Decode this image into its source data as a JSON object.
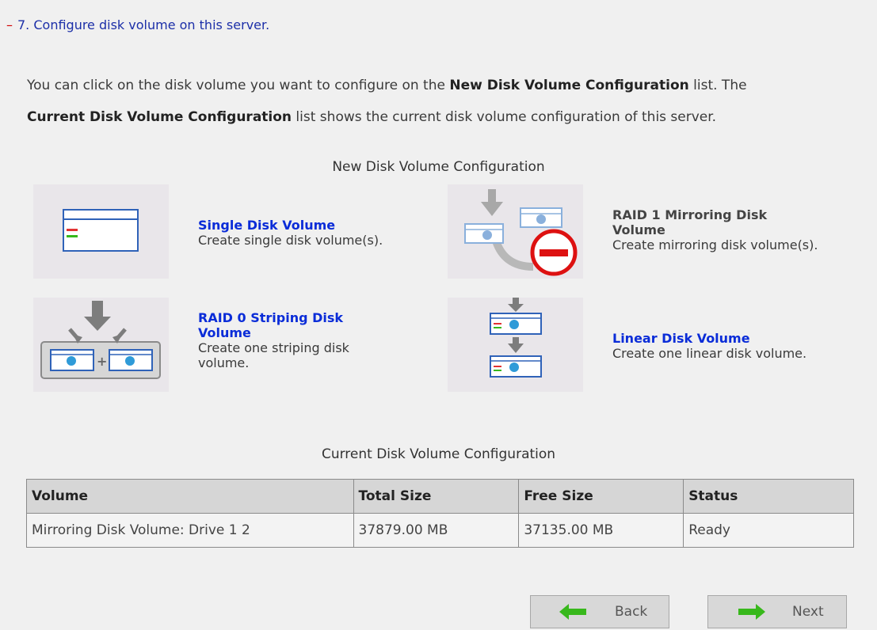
{
  "step": {
    "dash": "–",
    "text": "7. Configure disk volume on this server."
  },
  "intro": {
    "part1": "You can click on the disk volume you want to configure on the ",
    "bold1": "New Disk Volume Configuration",
    "part2": " list. The ",
    "bold2": "Current Disk Volume Configuration",
    "part3": " list shows the current disk volume configuration of this server."
  },
  "new_config": {
    "title": "New Disk Volume Configuration",
    "options": [
      {
        "title": "Single Disk Volume",
        "desc": "Create single disk volume(s).",
        "icon": "single-disk-icon"
      },
      {
        "title_line1": "RAID 1 Mirroring Disk",
        "title_line2": "Volume",
        "desc": "Create mirroring disk volume(s).",
        "icon": "raid1-mirroring-disabled-icon"
      },
      {
        "title_line1": "RAID 0 Striping Disk",
        "title_line2": "Volume",
        "desc_line1": "Create one striping disk",
        "desc_line2": "volume.",
        "icon": "raid0-striping-icon"
      },
      {
        "title": "Linear Disk Volume",
        "desc": "Create one linear disk volume.",
        "icon": "linear-disk-icon"
      }
    ]
  },
  "current_config": {
    "title": "Current Disk Volume Configuration",
    "columns": [
      "Volume",
      "Total Size",
      "Free Size",
      "Status"
    ],
    "rows": [
      [
        "Mirroring Disk Volume: Drive 1 2",
        "37879.00 MB",
        "37135.00 MB",
        "Ready"
      ]
    ]
  },
  "buttons": {
    "back": "Back",
    "next": "Next"
  },
  "colors": {
    "link": "#0a2cd8",
    "step": "#1c2fa8",
    "arrow_green": "#38b81c",
    "disabled_red": "#dd1111"
  }
}
